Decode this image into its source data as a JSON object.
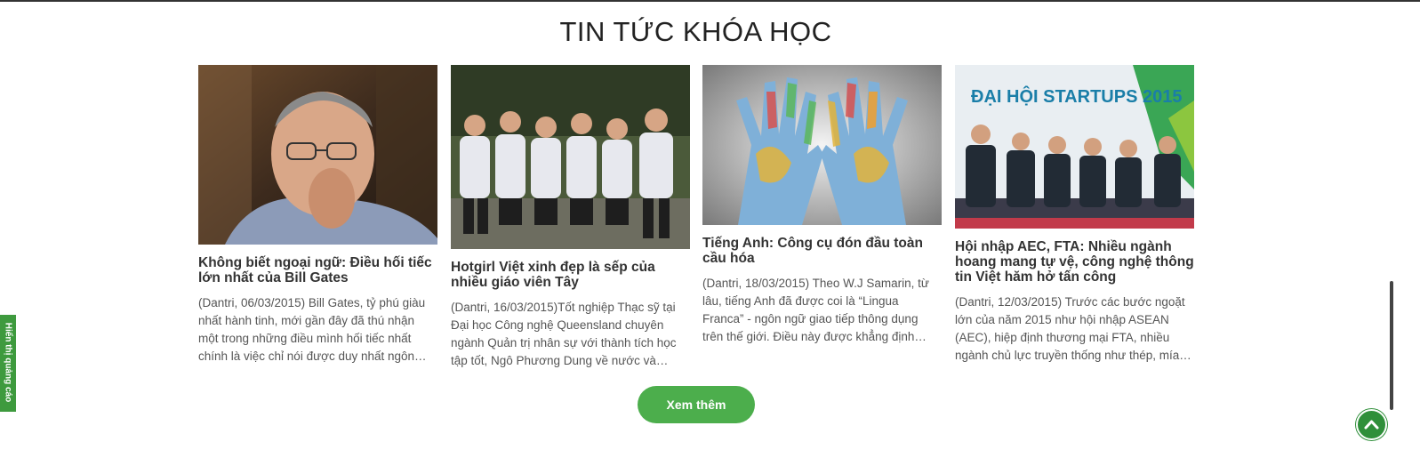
{
  "section": {
    "title": "TIN TỨC KHÓA HỌC"
  },
  "articles": [
    {
      "title": "Không biết ngoại ngữ: Điều hối tiếc lớn nhất của Bill Gates",
      "excerpt": "(Dantri, 06/03/2015) Bill Gates, tỷ phú giàu nhất hành tinh, mới gần đây đã thú nhận một trong những điều mình hối tiếc nhất chính là việc chỉ nói được duy nhất ngôn…"
    },
    {
      "title": "Hotgirl Việt xinh đẹp là sếp của nhiều giáo viên Tây",
      "excerpt": "(Dantri, 16/03/2015)Tốt nghiệp Thạc sỹ tại Đại học Công nghệ Queensland chuyên ngành Quản trị nhân sự với thành tích học tập tốt, Ngô Phương Dung về nước và nha…"
    },
    {
      "title": "Tiếng Anh: Công cụ đón đầu toàn cầu hóa",
      "excerpt": "(Dantri, 18/03/2015) Theo W.J Samarin, từ lâu, tiếng Anh đã được coi là “Lingua Franca” - ngôn ngữ giao tiếp thông dụng trên thế giới. Điều này được khẳng định…"
    },
    {
      "title": "Hội nhập AEC, FTA: Nhiều ngành hoang mang tự vệ, công nghệ thông tin Việt hăm hở tấn công",
      "excerpt": "(Dantri, 12/03/2015) Trước các bước ngoặt lớn của năm 2015 như hội nhập ASEAN (AEC), hiệp định thương mại FTA, nhiều ngành chủ lực truyền thống như thép, mía…"
    }
  ],
  "banner": {
    "text": "ĐẠI HỘI STARTUPS 2015"
  },
  "more_button": {
    "label": "Xem thêm"
  },
  "ads_tab": {
    "label": "Hiển thị quảng cáo"
  },
  "icons": {
    "scroll_top": "chevron-up-icon"
  },
  "colors": {
    "accent_green": "#4cae4c"
  }
}
